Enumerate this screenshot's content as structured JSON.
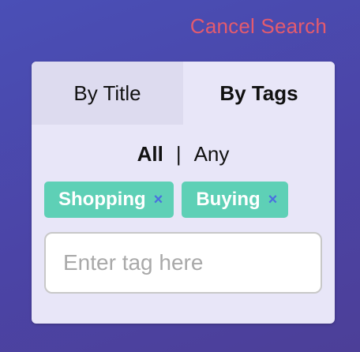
{
  "header": {
    "cancel_label": "Cancel Search"
  },
  "tabs": [
    {
      "label": "By Title",
      "active": false
    },
    {
      "label": "By Tags",
      "active": true
    }
  ],
  "match_mode": {
    "all_label": "All",
    "separator": "|",
    "any_label": "Any",
    "selected": "All"
  },
  "tags": [
    {
      "label": "Shopping",
      "remove_symbol": "×"
    },
    {
      "label": "Buying",
      "remove_symbol": "×"
    }
  ],
  "tag_input": {
    "value": "",
    "placeholder": "Enter tag here"
  },
  "colors": {
    "accent_cancel": "#e35b6e",
    "chip_background": "#5ed0b6",
    "chip_remove": "#4a6fe0",
    "panel_background": "#e8e6f8"
  }
}
